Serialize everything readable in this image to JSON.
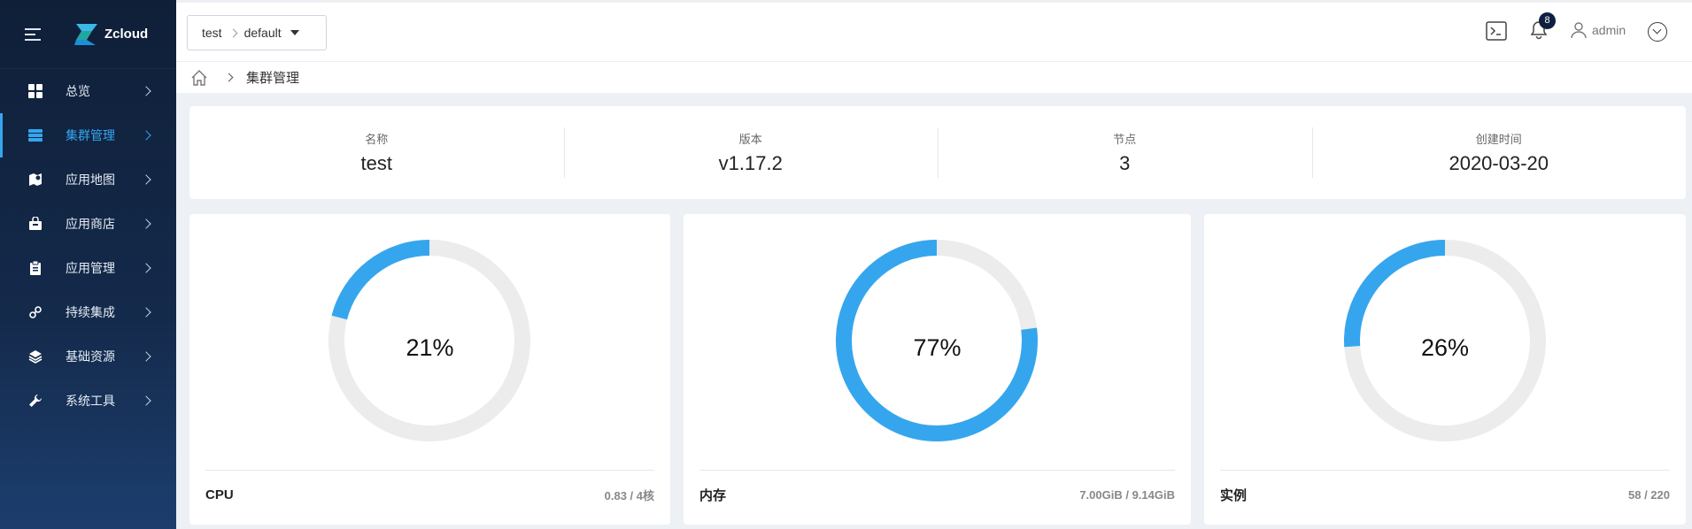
{
  "app": {
    "name": "Zcloud"
  },
  "sidebar": {
    "items": [
      {
        "label": "总览",
        "icon": "dashboard-grid-icon",
        "active": false
      },
      {
        "label": "集群管理",
        "icon": "server-icon",
        "active": true
      },
      {
        "label": "应用地图",
        "icon": "map-icon",
        "active": false
      },
      {
        "label": "应用商店",
        "icon": "shopping-bag-icon",
        "active": false
      },
      {
        "label": "应用管理",
        "icon": "clipboard-icon",
        "active": false
      },
      {
        "label": "持续集成",
        "icon": "link-icon",
        "active": false
      },
      {
        "label": "基础资源",
        "icon": "layers-icon",
        "active": false
      },
      {
        "label": "系统工具",
        "icon": "wrench-icon",
        "active": false
      }
    ]
  },
  "topbar": {
    "cluster": "test",
    "namespace": "default",
    "notifications_count": "8",
    "user": "admin"
  },
  "breadcrumb": {
    "current": "集群管理"
  },
  "cluster_info": [
    {
      "label": "名称",
      "value": "test"
    },
    {
      "label": "版本",
      "value": "v1.17.2"
    },
    {
      "label": "节点",
      "value": "3"
    },
    {
      "label": "创建时间",
      "value": "2020-03-20"
    }
  ],
  "gauges": [
    {
      "name": "CPU",
      "percent": 21,
      "percent_label": "21%",
      "usage": "0.83 / 4核"
    },
    {
      "name": "内存",
      "percent": 77,
      "percent_label": "77%",
      "usage": "7.00GiB / 9.14GiB"
    },
    {
      "name": "实例",
      "percent": 26,
      "percent_label": "26%",
      "usage": "58 / 220"
    }
  ],
  "colors": {
    "accent": "#35a6ee",
    "track": "#ececec",
    "sidebar": "#142a4b"
  }
}
